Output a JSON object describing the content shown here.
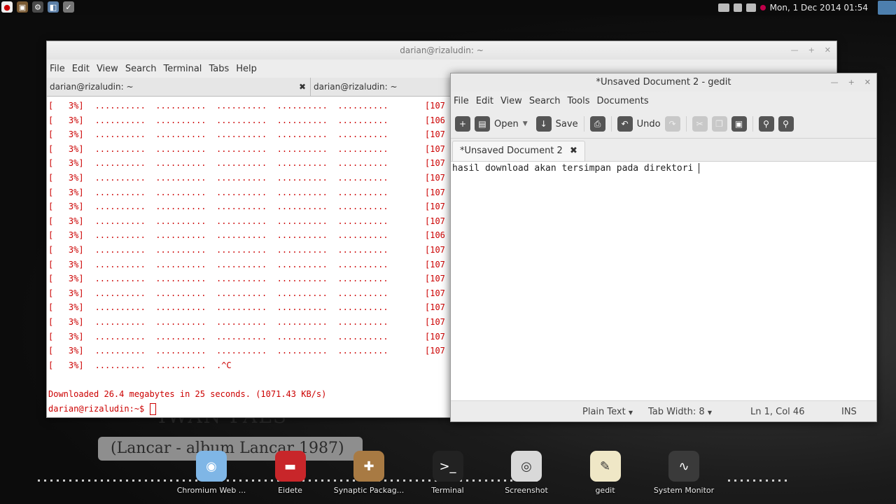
{
  "topbar": {
    "clock": "Mon,  1 Dec 2014 01:54"
  },
  "terminal": {
    "title": "darian@rizaludin: ~",
    "menu": [
      "File",
      "Edit",
      "View",
      "Search",
      "Terminal",
      "Tabs",
      "Help"
    ],
    "tabs": [
      {
        "label": "darian@rizaludin: ~"
      },
      {
        "label": "darian@rizaludin: ~"
      }
    ],
    "progress_lines": [
      {
        "pct": "[   3%]",
        "dots": "..........  ..........  ..........  ..........  ..........",
        "rate": "[107"
      },
      {
        "pct": "[   3%]",
        "dots": "..........  ..........  ..........  ..........  ..........",
        "rate": "[106"
      },
      {
        "pct": "[   3%]",
        "dots": "..........  ..........  ..........  ..........  ..........",
        "rate": "[107"
      },
      {
        "pct": "[   3%]",
        "dots": "..........  ..........  ..........  ..........  ..........",
        "rate": "[107"
      },
      {
        "pct": "[   3%]",
        "dots": "..........  ..........  ..........  ..........  ..........",
        "rate": "[107"
      },
      {
        "pct": "[   3%]",
        "dots": "..........  ..........  ..........  ..........  ..........",
        "rate": "[107"
      },
      {
        "pct": "[   3%]",
        "dots": "..........  ..........  ..........  ..........  ..........",
        "rate": "[107"
      },
      {
        "pct": "[   3%]",
        "dots": "..........  ..........  ..........  ..........  ..........",
        "rate": "[107"
      },
      {
        "pct": "[   3%]",
        "dots": "..........  ..........  ..........  ..........  ..........",
        "rate": "[107"
      },
      {
        "pct": "[   3%]",
        "dots": "..........  ..........  ..........  ..........  ..........",
        "rate": "[106"
      },
      {
        "pct": "[   3%]",
        "dots": "..........  ..........  ..........  ..........  ..........",
        "rate": "[107"
      },
      {
        "pct": "[   3%]",
        "dots": "..........  ..........  ..........  ..........  ..........",
        "rate": "[107"
      },
      {
        "pct": "[   3%]",
        "dots": "..........  ..........  ..........  ..........  ..........",
        "rate": "[107"
      },
      {
        "pct": "[   3%]",
        "dots": "..........  ..........  ..........  ..........  ..........",
        "rate": "[107"
      },
      {
        "pct": "[   3%]",
        "dots": "..........  ..........  ..........  ..........  ..........",
        "rate": "[107"
      },
      {
        "pct": "[   3%]",
        "dots": "..........  ..........  ..........  ..........  ..........",
        "rate": "[107"
      },
      {
        "pct": "[   3%]",
        "dots": "..........  ..........  ..........  ..........  ..........",
        "rate": "[107"
      },
      {
        "pct": "[   3%]",
        "dots": "..........  ..........  ..........  ..........  ..........",
        "rate": "[107"
      },
      {
        "pct": "[   3%]",
        "dots": "..........  ..........  .^C",
        "rate": ""
      }
    ],
    "summary": "Downloaded 26.4 megabytes in 25 seconds. (1071.43 KB/s)",
    "prompt": "darian@rizaludin:~$ "
  },
  "gedit": {
    "title": "*Unsaved Document 2 - gedit",
    "menu": [
      "File",
      "Edit",
      "View",
      "Search",
      "Tools",
      "Documents"
    ],
    "toolbar": {
      "open": "Open",
      "save": "Save",
      "undo": "Undo"
    },
    "tab_label": "*Unsaved Document 2",
    "content": "hasil download akan tersimpan pada direktori",
    "status": {
      "language": "Plain Text",
      "tab_width": "Tab Width: 8",
      "position": "Ln 1, Col 46",
      "mode": "INS"
    }
  },
  "wallpaper": {
    "title": "IWAN FALS",
    "subtitle": "(Lancar - album Lancar 1987)"
  },
  "dock": [
    {
      "label": "Chromium Web ...",
      "icon": "chromium-icon",
      "color": "#7fb6e6"
    },
    {
      "label": "Eidete",
      "icon": "eidete-icon",
      "color": "#c8262a"
    },
    {
      "label": "Synaptic Packag...",
      "icon": "synaptic-icon",
      "color": "#a87a43"
    },
    {
      "label": "Terminal",
      "icon": "terminal-icon",
      "color": "#222222"
    },
    {
      "label": "Screenshot",
      "icon": "screenshot-icon",
      "color": "#d9d9d9"
    },
    {
      "label": "gedit",
      "icon": "gedit-icon",
      "color": "#efe7c6"
    },
    {
      "label": "System Monitor",
      "icon": "system-monitor-icon",
      "color": "#3a3a3a"
    }
  ]
}
